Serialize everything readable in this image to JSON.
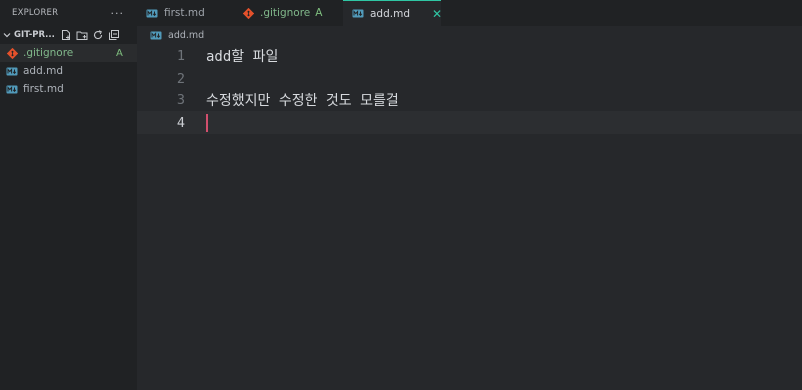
{
  "sidebar": {
    "header_title": "EXPLORER",
    "more_label": "···",
    "section_title": "GIT-PR...",
    "files": [
      {
        "name": ".gitignore",
        "badge": "A",
        "icon": "git-file-icon"
      },
      {
        "name": "add.md",
        "icon": "markdown-icon"
      },
      {
        "name": "first.md",
        "icon": "markdown-icon"
      }
    ]
  },
  "tabs": [
    {
      "label": "first.md",
      "icon": "markdown-icon"
    },
    {
      "label": ".gitignore",
      "badge": "A",
      "icon": "git-file-icon"
    },
    {
      "label": "add.md",
      "icon": "markdown-icon",
      "active": true,
      "close": "✕"
    }
  ],
  "breadcrumb": {
    "label": "add.md"
  },
  "editor": {
    "lines": [
      {
        "number": "1",
        "text": "add할 파일"
      },
      {
        "number": "2",
        "text": ""
      },
      {
        "number": "3",
        "text": "수정했지만 수정한 것도 모를걸"
      },
      {
        "number": "4",
        "text": ""
      }
    ]
  },
  "colors": {
    "accent": "#2fc6a4",
    "git_added": "#7fbf7f",
    "git_icon": "#e4512b",
    "markdown_icon": "#519aba",
    "cursor": "#d14f6d"
  }
}
